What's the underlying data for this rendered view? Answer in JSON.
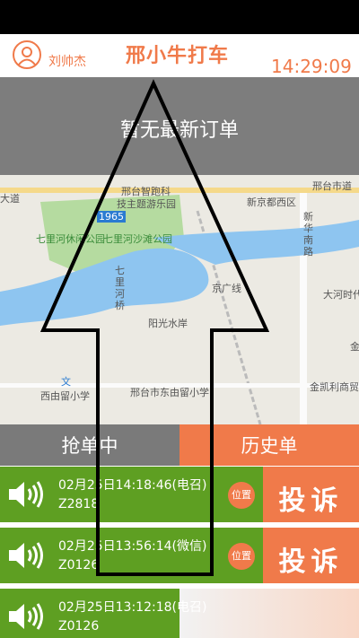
{
  "header": {
    "username": "刘帅杰",
    "title": "邢小牛打车",
    "time": "14:29:09"
  },
  "banner": {
    "text": "暂无最新订单"
  },
  "map": {
    "labels": [
      "邢台智跑科",
      "技主题游乐园",
      "1965",
      "七里河休闲公园",
      "七里河沙滩公园",
      "新京都西区",
      "邢台市道",
      "新华南路",
      "大河时代",
      "七里河桥",
      "阳光水岸",
      "京广线",
      "金凯利商贸",
      "西由留小学",
      "邢台市东由留小学",
      "文",
      "大道",
      "金"
    ]
  },
  "tabs": {
    "grab": "抢单中",
    "history": "历史单"
  },
  "orders": [
    {
      "time": "02月25日14:18:46(电召)",
      "code": "Z2818",
      "position": "位置",
      "complain": "投诉"
    },
    {
      "time": "02月25日13:56:14(微信)",
      "code": "Z0126",
      "position": "位置",
      "complain": "投诉"
    },
    {
      "time": "02月25日13:12:18(电召)",
      "code": "Z0126"
    }
  ],
  "colors": {
    "accent": "#f07a4a",
    "green": "#5e9f22",
    "gray": "#7a7a7a"
  }
}
